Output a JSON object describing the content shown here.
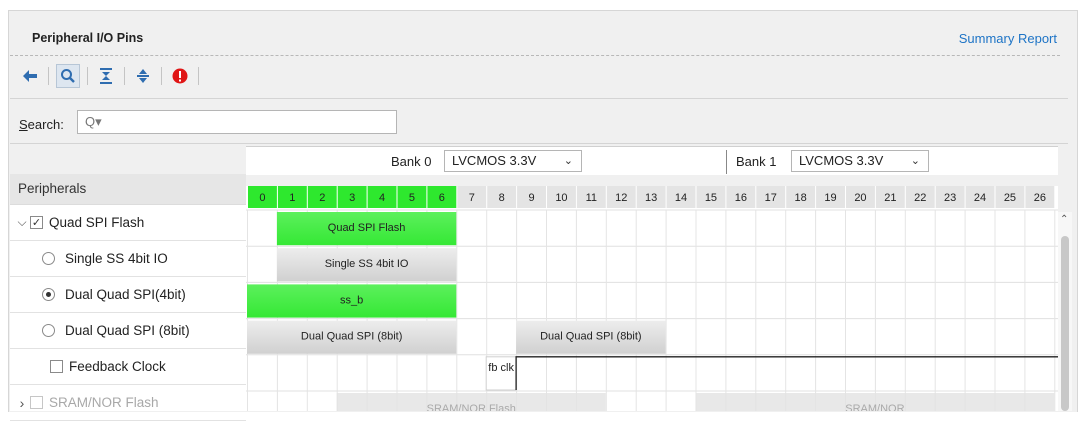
{
  "header": {
    "title": "Peripheral I/O Pins",
    "summary_link": "Summary Report"
  },
  "toolbar": {
    "icons": [
      "back-arrow-icon",
      "search-icon",
      "collapse-all-icon",
      "expand-all-icon",
      "error-icon"
    ]
  },
  "search": {
    "label": "Search:",
    "value": "",
    "icon": "Q▾"
  },
  "banks": [
    {
      "label": "Bank 0",
      "voltage": "LVCMOS 3.3V"
    },
    {
      "label": "Bank 1",
      "voltage": "LVCMOS 3.3V"
    }
  ],
  "peripherals": {
    "header": "Peripherals",
    "items": [
      {
        "label": "Quad SPI Flash",
        "type": "checkbox",
        "checked": true,
        "expanded": true,
        "enabled": true
      },
      {
        "label": "Single SS 4bit IO",
        "type": "radio",
        "checked": false,
        "enabled": true
      },
      {
        "label": "Dual Quad SPI(4bit)",
        "type": "radio",
        "checked": true,
        "enabled": true
      },
      {
        "label": "Dual Quad SPI (8bit)",
        "type": "radio",
        "checked": false,
        "enabled": true
      },
      {
        "label": "Feedback Clock",
        "type": "checkbox",
        "checked": false,
        "enabled": true
      },
      {
        "label": "SRAM/NOR Flash",
        "type": "checkbox",
        "checked": false,
        "expanded": false,
        "enabled": false
      }
    ]
  },
  "pins": [
    "0",
    "1",
    "2",
    "3",
    "4",
    "5",
    "6",
    "7",
    "8",
    "9",
    "10",
    "11",
    "12",
    "13",
    "14",
    "15",
    "16",
    "17",
    "18",
    "19",
    "20",
    "21",
    "22",
    "23",
    "24",
    "25",
    "26"
  ],
  "pin_colors": {
    "green": "#2ee82e",
    "gray": "#e4e4e4",
    "block_green": "#35e835",
    "block_gray": "#d0d0d0"
  },
  "green_pins_through": 6,
  "row_blocks": [
    [
      {
        "label": "Quad SPI Flash",
        "from": 1,
        "to": 6,
        "color": "green"
      }
    ],
    [
      {
        "label": "Single SS 4bit IO",
        "from": 1,
        "to": 6,
        "color": "gray"
      }
    ],
    [
      {
        "label": "ss_b",
        "from": 0,
        "to": 6,
        "color": "green"
      }
    ],
    [
      {
        "label": "Dual Quad SPI (8bit)",
        "from": 0,
        "to": 6,
        "color": "gray"
      },
      {
        "label": "Dual Quad SPI (8bit)",
        "from": 9,
        "to": 13,
        "color": "gray"
      }
    ],
    [
      {
        "label": "fb clk",
        "from": 8,
        "to": 8,
        "color": "white"
      }
    ],
    [
      {
        "label": "SRAM/NOR Flash",
        "from": 3,
        "to": 11,
        "color": "faded"
      },
      {
        "label": "SRAM/NOR",
        "from": 15,
        "to": 26,
        "color": "faded"
      }
    ]
  ]
}
